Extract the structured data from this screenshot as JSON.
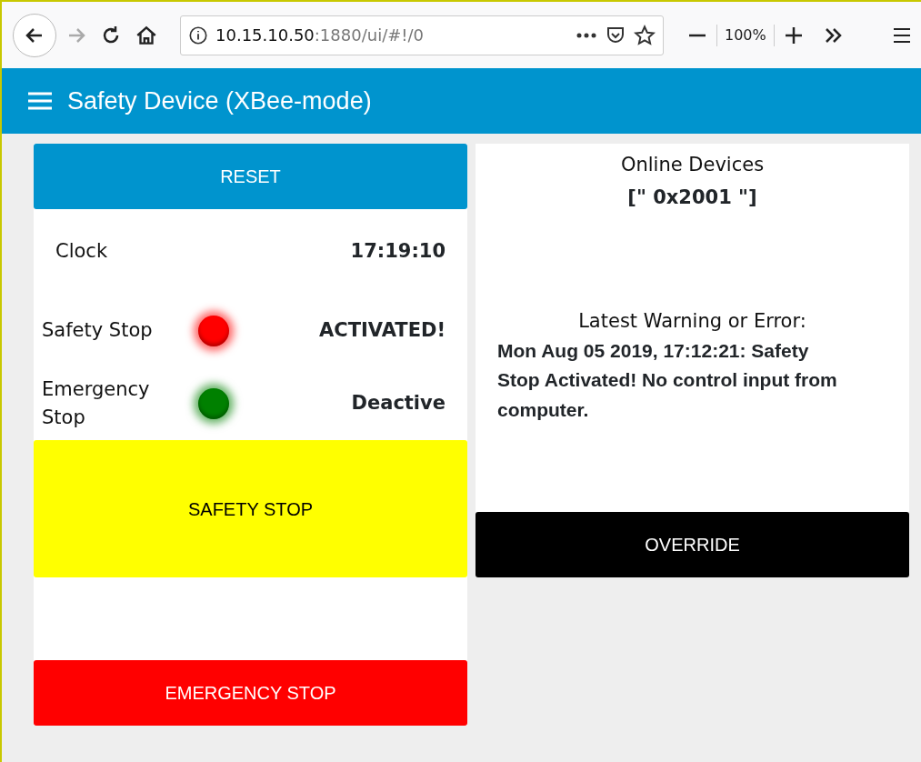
{
  "browser": {
    "url_host": "10.15.10.50",
    "url_path": ":1880/ui/#!/0",
    "zoom": "100%"
  },
  "header": {
    "title": "Safety Device (XBee-mode)"
  },
  "left_panel": {
    "reset_button": "RESET",
    "clock": {
      "label": "Clock",
      "value": "17:19:10"
    },
    "indicators": [
      {
        "label": "Safety Stop",
        "color": "#ff0000",
        "value": "ACTIVATED!"
      },
      {
        "label": "Emergency Stop",
        "color": "#008000",
        "value": "Deactive"
      }
    ],
    "safety_button": "SAFETY STOP",
    "emergency_button": "EMERGENCY STOP"
  },
  "right_panel": {
    "online_title": "Online Devices",
    "online_value": "[\" 0x2001 \"]",
    "warning_title": "Latest Warning or Error:",
    "warning_text": "Mon Aug 05 2019, 17:12:21: Safety Stop Activated! No control input from computer.",
    "override_button": "OVERRIDE"
  }
}
